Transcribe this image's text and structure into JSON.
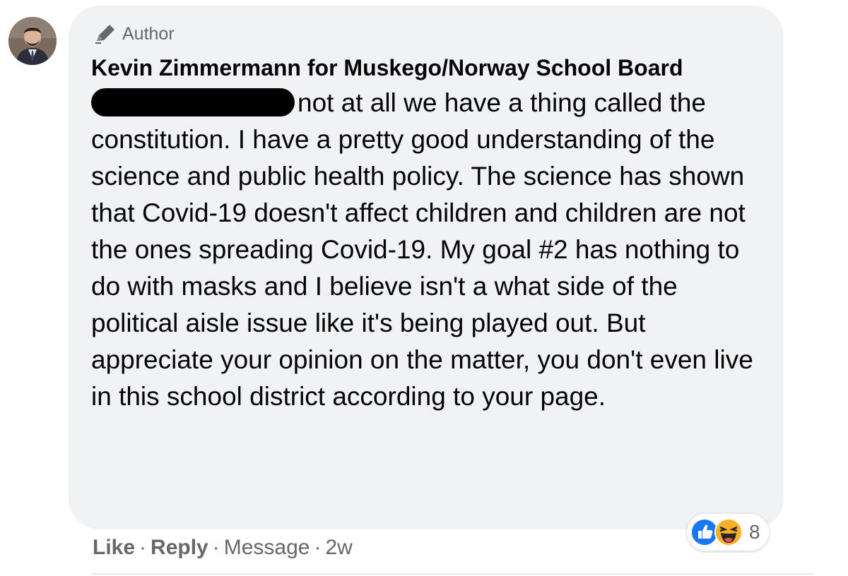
{
  "comment": {
    "author_badge": "Author",
    "commenter_name": "Kevin Zimmermann for Muskego/Norway School Board",
    "body_text": "not at all we have a thing called the constitution. I have a pretty good understanding of the science and public health policy. The science has shown that Covid-19 doesn't affect children and children are not the ones spreading Covid-19. My goal #2 has nothing to do with masks and I believe isn't a what side of the political aisle issue like it's being played out. But appreciate your opinion on the matter, you don't even live in this school district according to your page."
  },
  "actions": {
    "like_label": "Like",
    "reply_label": "Reply",
    "message_label": "Message",
    "separator": "·",
    "timestamp": "2w"
  },
  "reactions": {
    "types": [
      "like-icon",
      "haha-icon"
    ],
    "count": "8"
  },
  "colors": {
    "bubble_bg": "#f0f2f5",
    "text_primary": "#050505",
    "text_secondary": "#65676b",
    "like_blue": "#1877f2",
    "haha_yellow": "#f7b125"
  }
}
